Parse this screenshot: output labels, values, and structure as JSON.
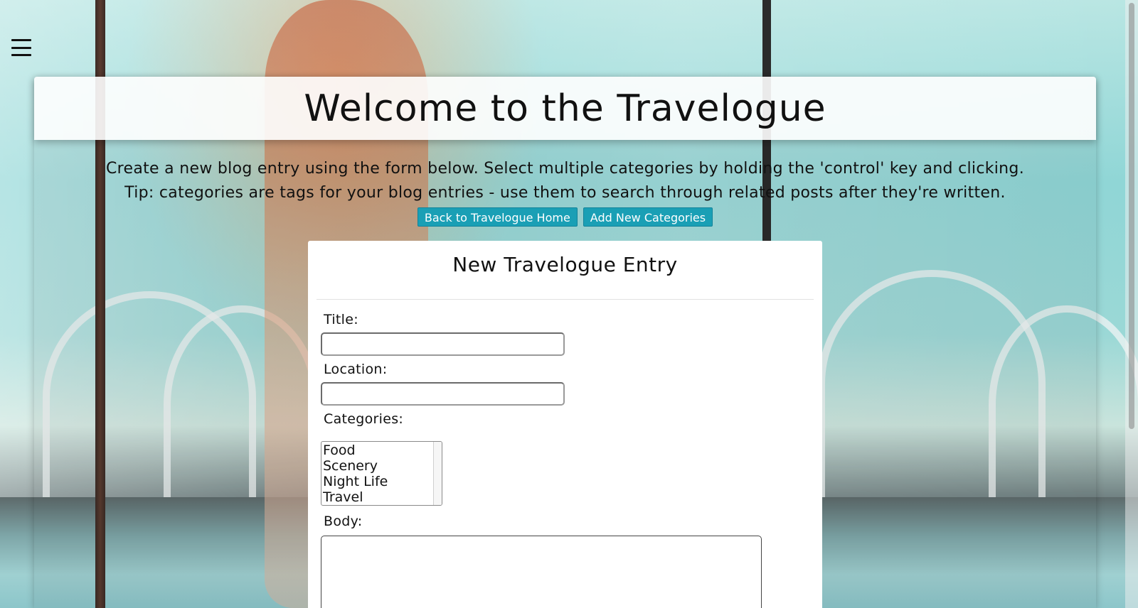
{
  "header": {
    "title": "Welcome to the Travelogue"
  },
  "intro": {
    "line1": "Create a new blog entry using the form below. Select multiple categories by holding the 'control' key and clicking.",
    "line2": "Tip: categories are tags for your blog entries - use them to search through related posts after they're written."
  },
  "nav": {
    "back_label": "Back to Travelogue Home",
    "add_categories_label": "Add New Categories"
  },
  "form": {
    "heading": "New Travelogue Entry",
    "title_label": "Title:",
    "title_value": "",
    "location_label": "Location:",
    "location_value": "",
    "categories_label": "Categories:",
    "categories": [
      "Food",
      "Scenery",
      "Night Life",
      "Travel"
    ],
    "body_label": "Body:",
    "body_value": ""
  },
  "icons": {
    "menu": "hamburger-menu-icon"
  },
  "colors": {
    "button_bg": "#1a9fb5",
    "button_text": "#ffffff"
  }
}
